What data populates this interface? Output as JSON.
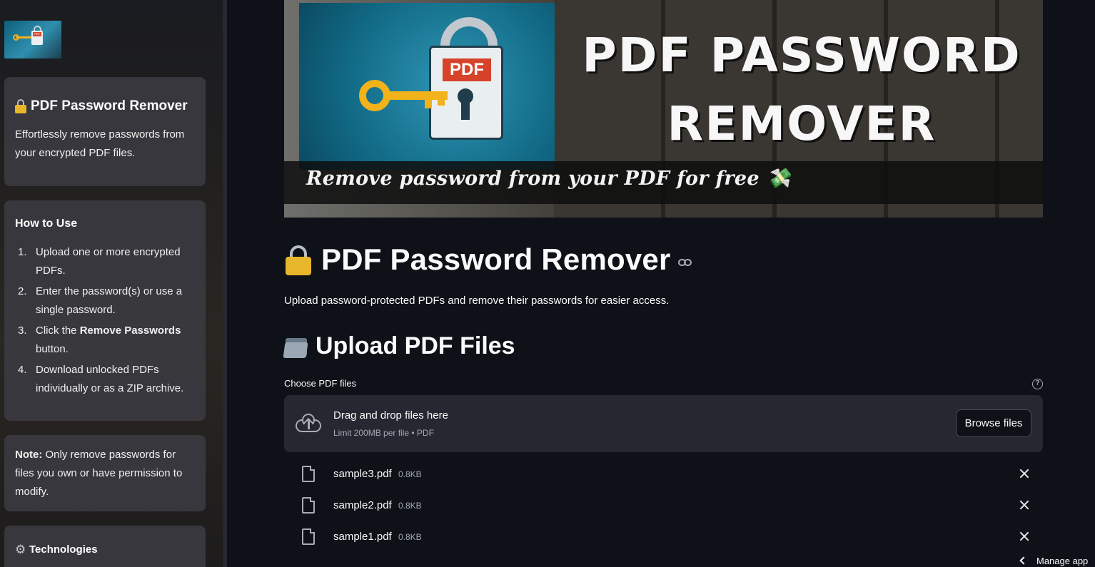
{
  "sidebar": {
    "about": {
      "title": "PDF Password Remover",
      "text": "Effortlessly remove passwords from your encrypted PDF files."
    },
    "how_to": {
      "title": "How to Use",
      "steps": [
        {
          "num": "1.",
          "text": "Upload one or more encrypted PDFs."
        },
        {
          "num": "2.",
          "text": "Enter the password(s) or use a single password."
        },
        {
          "num": "3.",
          "pre": "Click the ",
          "bold": "Remove Passwords",
          "post": " button."
        },
        {
          "num": "4.",
          "text": "Download unlocked PDFs individually or as a ZIP archive."
        }
      ]
    },
    "note": {
      "bold": "Note:",
      "text": " Only remove passwords for files you own or have permission to modify."
    },
    "technologies": {
      "title": "Technologies"
    }
  },
  "banner": {
    "title_line1": "PDF PASSWORD",
    "title_line2": "REMOVER",
    "tagline": "Remove password from your PDF for free",
    "pdf_tag": "PDF"
  },
  "main": {
    "title": "PDF Password Remover",
    "subtitle": "Upload password-protected PDFs and remove their passwords for easier access.",
    "upload_heading": "Upload PDF Files",
    "uploader": {
      "label": "Choose PDF files",
      "drop_text": "Drag and drop files here",
      "limit_text": "Limit 200MB per file • PDF",
      "browse_label": "Browse files"
    },
    "files": [
      {
        "name": "sample3.pdf",
        "size": "0.8KB"
      },
      {
        "name": "sample2.pdf",
        "size": "0.8KB"
      },
      {
        "name": "sample1.pdf",
        "size": "0.8KB"
      }
    ]
  },
  "footer": {
    "manage_app": "Manage app"
  },
  "colors": {
    "background": "#0e1117",
    "card": "#3a3a40",
    "dropzone": "#262730",
    "lock_gold": "#e8b62b",
    "pdf_red": "#d6432a"
  }
}
